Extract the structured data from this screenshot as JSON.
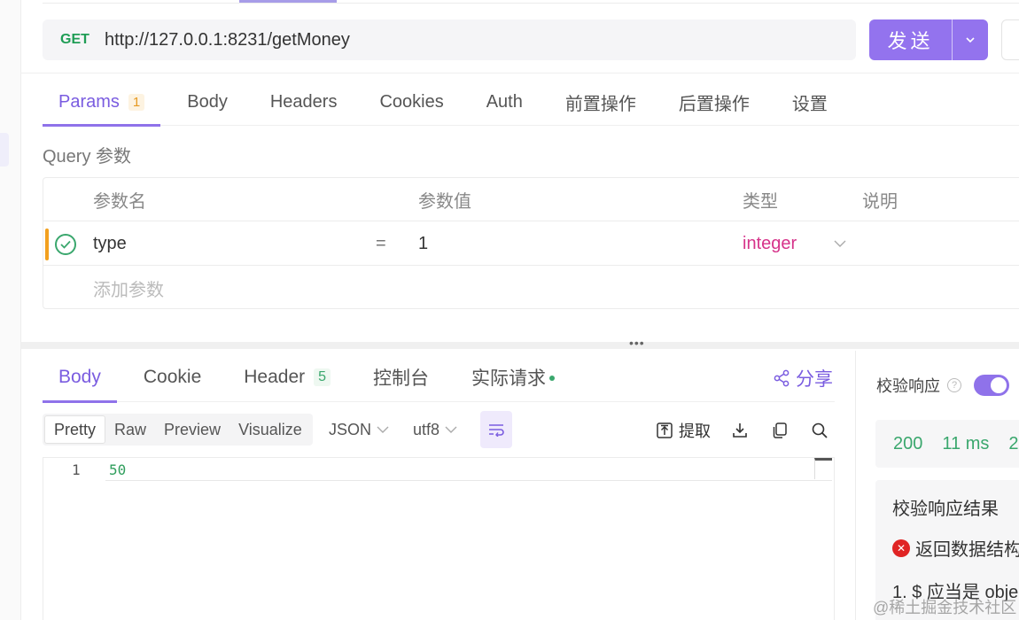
{
  "request": {
    "method": "GET",
    "url": "http://127.0.0.1:8231/getMoney",
    "send_label": "发送"
  },
  "request_tabs": [
    {
      "label": "Params",
      "badge": "1",
      "active": true
    },
    {
      "label": "Body"
    },
    {
      "label": "Headers"
    },
    {
      "label": "Cookies"
    },
    {
      "label": "Auth"
    },
    {
      "label": "前置操作"
    },
    {
      "label": "后置操作"
    },
    {
      "label": "设置"
    }
  ],
  "query": {
    "title": "Query 参数",
    "columns": [
      "参数名",
      "参数值",
      "类型",
      "说明"
    ],
    "rows": [
      {
        "name": "type",
        "op": "=",
        "value": "1",
        "type": "integer",
        "enabled": true
      }
    ],
    "add_placeholder": "添加参数"
  },
  "response_tabs": [
    {
      "label": "Body",
      "active": true
    },
    {
      "label": "Cookie"
    },
    {
      "label": "Header",
      "count": "5"
    },
    {
      "label": "控制台"
    },
    {
      "label": "实际请求"
    }
  ],
  "share_label": "分享",
  "view_modes": [
    "Pretty",
    "Raw",
    "Preview",
    "Visualize"
  ],
  "format": "JSON",
  "encoding": "utf8",
  "extract_label": "提取",
  "editor": {
    "line_number": "1",
    "content": "50"
  },
  "verify": {
    "label": "校验响应",
    "enabled": true
  },
  "stats": {
    "status": "200",
    "time": "11 ms",
    "size": "2"
  },
  "result": {
    "title": "校验响应结果",
    "error": "返回数据结构",
    "detail": "1. $ 应当是 obje"
  },
  "watermark": "@稀土掘金技术社区",
  "colors": {
    "accent": "#8f72ea",
    "method_get": "#1f9d55",
    "status_ok": "#3aa76d",
    "type_text": "#d6338a",
    "row_flag": "#f2a01f",
    "error": "#e02424"
  }
}
